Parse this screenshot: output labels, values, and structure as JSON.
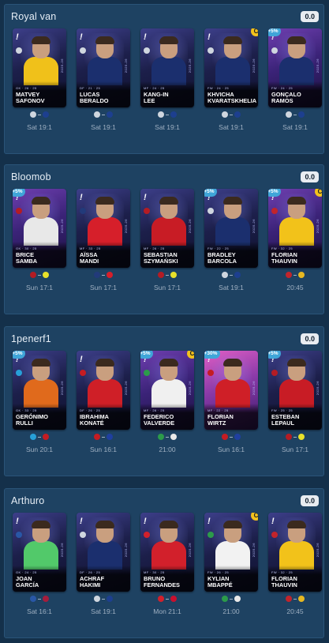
{
  "teams": [
    {
      "name": "Royal van",
      "score": "0.0",
      "players": [
        {
          "name1": "MATVEY",
          "name2": "SAFONOV",
          "meta": "GK · 26 · 25",
          "time": "Sat 19:1",
          "boost": "",
          "captain": false,
          "card": "blue",
          "shirt": "#f0c11a",
          "home": "#cfd6df",
          "away": "#1d3f8f"
        },
        {
          "name1": "LUCAS",
          "name2": "BERALDO",
          "meta": "DF · 21 · 25",
          "time": "Sat 19:1",
          "boost": "",
          "captain": false,
          "card": "blue",
          "shirt": "#1b2f6e",
          "home": "#cfd6df",
          "away": "#1d3f8f"
        },
        {
          "name1": "KANG-IN",
          "name2": "LEE",
          "meta": "MF · 24 · 25",
          "time": "Sat 19:1",
          "boost": "",
          "captain": false,
          "card": "blue",
          "shirt": "#1b2f6e",
          "home": "#cfd6df",
          "away": "#1d3f8f"
        },
        {
          "name1": "KHVICHA",
          "name2": "KVARATSKHELIA",
          "meta": "FW · 24 · 25",
          "time": "Sat 19:1",
          "boost": "",
          "captain": true,
          "card": "blue",
          "shirt": "#1b2f6e",
          "home": "#cfd6df",
          "away": "#1d3f8f"
        },
        {
          "name1": "GONÇALO",
          "name2": "RAMOS",
          "meta": "FW · 24 · 25",
          "time": "Sat 19:1",
          "boost": "+5%",
          "captain": false,
          "card": "purple",
          "shirt": "#1b2f6e",
          "home": "#cfd6df",
          "away": "#1d3f8f"
        }
      ]
    },
    {
      "name": "Bloomob",
      "score": "0.0",
      "players": [
        {
          "name1": "BRICE",
          "name2": "SAMBA",
          "meta": "GK · 30 · 25",
          "time": "Sun 17:1",
          "boost": "+5%",
          "captain": false,
          "card": "purple",
          "shirt": "#e8e8e8",
          "home": "#b31c24",
          "away": "#e8e12a"
        },
        {
          "name1": "AÏSSA",
          "name2": "MANDI",
          "meta": "MF · 33 · 25",
          "time": "Sun 17:1",
          "boost": "",
          "captain": false,
          "card": "blue",
          "shirt": "#d61f2a",
          "home": "#223a7a",
          "away": "#d61f2a"
        },
        {
          "name1": "SEBASTIAN",
          "name2": "SZYMAŃSKI",
          "meta": "MF · 26 · 25",
          "time": "Sun 17:1",
          "boost": "",
          "captain": false,
          "card": "blue",
          "shirt": "#c81c25",
          "home": "#b31c24",
          "away": "#e8e12a"
        },
        {
          "name1": "BRADLEY",
          "name2": "BARCOLA",
          "meta": "FW · 22 · 25",
          "time": "Sat 19:1",
          "boost": "+5%",
          "captain": false,
          "card": "blue",
          "shirt": "#1b2f6e",
          "home": "#cfd6df",
          "away": "#1d3f8f"
        },
        {
          "name1": "FLORIAN",
          "name2": "THAUVIN",
          "meta": "FW · 32 · 25",
          "time": "20:45",
          "boost": "+5%",
          "captain": true,
          "card": "purple",
          "shirt": "#f2c21a",
          "home": "#c2242b",
          "away": "#e7b821"
        }
      ]
    },
    {
      "name": "1penerf1",
      "score": "0.0",
      "players": [
        {
          "name1": "GERÓNIMO",
          "name2": "RULLI",
          "meta": "GK · 33 · 25",
          "time": "Sun 20:1",
          "boost": "+5%",
          "captain": false,
          "card": "blue",
          "shirt": "#e06a1c",
          "home": "#27a0d8",
          "away": "#c41c22"
        },
        {
          "name1": "IBRAHIMA",
          "name2": "KONATÉ",
          "meta": "DF · 26 · 25",
          "time": "Sun 16:1",
          "boost": "",
          "captain": false,
          "card": "blue",
          "shirt": "#cf1f27",
          "home": "#c41c22",
          "away": "#1f3fa0"
        },
        {
          "name1": "FEDERICO",
          "name2": "VALVERDE",
          "meta": "MF · 26 · 25",
          "time": "21:00",
          "boost": "+5%",
          "captain": true,
          "card": "purple",
          "shirt": "#f0f0f0",
          "home": "#2c9b4a",
          "away": "#e9e9e9"
        },
        {
          "name1": "FLORIAN",
          "name2": "WIRTZ",
          "meta": "MF · 22 · 25",
          "time": "Sun 16:1",
          "boost": "+30%",
          "captain": false,
          "card": "pink",
          "shirt": "#cf1f27",
          "home": "#c41c22",
          "away": "#1f3fa0"
        },
        {
          "name1": "ESTEBAN",
          "name2": "LEPAUL",
          "meta": "FW · 25 · 25",
          "time": "Sun 17:1",
          "boost": "+5%",
          "captain": false,
          "card": "blue",
          "shirt": "#c81c25",
          "home": "#b31c24",
          "away": "#e8e12a"
        }
      ]
    },
    {
      "name": "Arthuro",
      "score": "0.0",
      "players": [
        {
          "name1": "JOAN",
          "name2": "GARCÍA",
          "meta": "GK · 24 · 25",
          "time": "Sat 16:1",
          "boost": "",
          "captain": false,
          "card": "blue",
          "shirt": "#52c96a",
          "home": "#2957a6",
          "away": "#a51d3c"
        },
        {
          "name1": "ACHRAF",
          "name2": "HAKIMI",
          "meta": "DF · 26 · 25",
          "time": "Sat 19:1",
          "boost": "",
          "captain": false,
          "card": "blue",
          "shirt": "#1b2f6e",
          "home": "#cfd6df",
          "away": "#1d3f8f"
        },
        {
          "name1": "BRUNO",
          "name2": "FERNANDES",
          "meta": "MF · 30 · 25",
          "time": "Mon 21:1",
          "boost": "",
          "captain": false,
          "card": "blue",
          "shirt": "#d2202b",
          "home": "#d2202b",
          "away": "#c8102e"
        },
        {
          "name1": "KYLIAN",
          "name2": "MBAPPÉ",
          "meta": "FW · 26 · 25",
          "time": "21:00",
          "boost": "",
          "captain": true,
          "card": "blue",
          "shirt": "#f2f2f2",
          "home": "#2c9b4a",
          "away": "#e9e9e9"
        },
        {
          "name1": "FLORIAN",
          "name2": "THAUVIN",
          "meta": "FW · 32 · 25",
          "time": "20:45",
          "boost": "",
          "captain": false,
          "card": "blue",
          "shirt": "#f2c21a",
          "home": "#c2242b",
          "away": "#e7b821"
        }
      ]
    }
  ]
}
